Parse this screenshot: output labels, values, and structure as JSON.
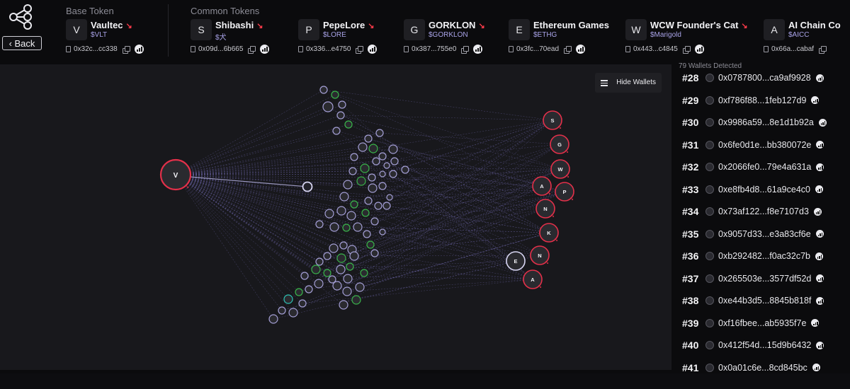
{
  "header": {
    "back_label": "Back",
    "base_label": "Base Token",
    "common_label": "Common Tokens"
  },
  "base_token": {
    "letter": "V",
    "name": "Vaultec",
    "symbol": "$VLT",
    "address": "0x32c...cc338",
    "trend": "↘"
  },
  "common_tokens": [
    {
      "letter": "S",
      "name": "Shibashi",
      "symbol": "$犬",
      "address": "0x09d...6b665",
      "trend": "↘"
    },
    {
      "letter": "P",
      "name": "PepeLore",
      "symbol": "$LORE",
      "address": "0x336...e4750",
      "trend": "↘"
    },
    {
      "letter": "G",
      "name": "GORKLON",
      "symbol": "$GORKLON",
      "address": "0x387...755e0",
      "trend": "↘"
    },
    {
      "letter": "E",
      "name": "Ethereum Games",
      "symbol": "$ETHG",
      "address": "0x3fc...70ead",
      "trend": ""
    },
    {
      "letter": "W",
      "name": "WCW Founder's Cat",
      "symbol": "$Marigold",
      "address": "0x443...c4845",
      "trend": "↘"
    },
    {
      "letter": "A",
      "name": "AI Chain Co",
      "symbol": "$AICC",
      "address": "0x66a...cabaf",
      "trend": ""
    }
  ],
  "graph": {
    "hide_wallets_label": "Hide Wallets",
    "base_node_label": "V",
    "target_nodes": [
      "S",
      "G",
      "W",
      "A",
      "P",
      "N",
      "K",
      "N",
      "A",
      "E"
    ],
    "colors": {
      "node_fill": "#2a2a2f",
      "node_stroke": "#a49fd6",
      "green_stroke": "#39b54a",
      "teal_stroke": "#2ec4b6",
      "red_ring": "#e4304a",
      "edge": "#7a72c0"
    }
  },
  "wallets": {
    "count_label": "79 Wallets Detected",
    "items": [
      {
        "rank": "#28",
        "address": "0x0787800...ca9af9928"
      },
      {
        "rank": "#29",
        "address": "0xf786f88...1feb127d9"
      },
      {
        "rank": "#30",
        "address": "0x9986a59...8e1d1b92a"
      },
      {
        "rank": "#31",
        "address": "0x6fe0d1e...bb380072e"
      },
      {
        "rank": "#32",
        "address": "0x2066fe0...79e4a631a"
      },
      {
        "rank": "#33",
        "address": "0xe8fb4d8...61a9ce4c0"
      },
      {
        "rank": "#34",
        "address": "0x73af122...f8e7107d3"
      },
      {
        "rank": "#35",
        "address": "0x9057d33...e3a83cf6e"
      },
      {
        "rank": "#36",
        "address": "0xb292482...f0ac32c7b"
      },
      {
        "rank": "#37",
        "address": "0x265503e...3577df52d"
      },
      {
        "rank": "#38",
        "address": "0xe44b3d5...8845b818f"
      },
      {
        "rank": "#39",
        "address": "0xf16fbee...ab5935f7e"
      },
      {
        "rank": "#40",
        "address": "0x412f54d...15d9b6432"
      },
      {
        "rank": "#41",
        "address": "0x0a01c6e...8cd845bc"
      }
    ]
  }
}
